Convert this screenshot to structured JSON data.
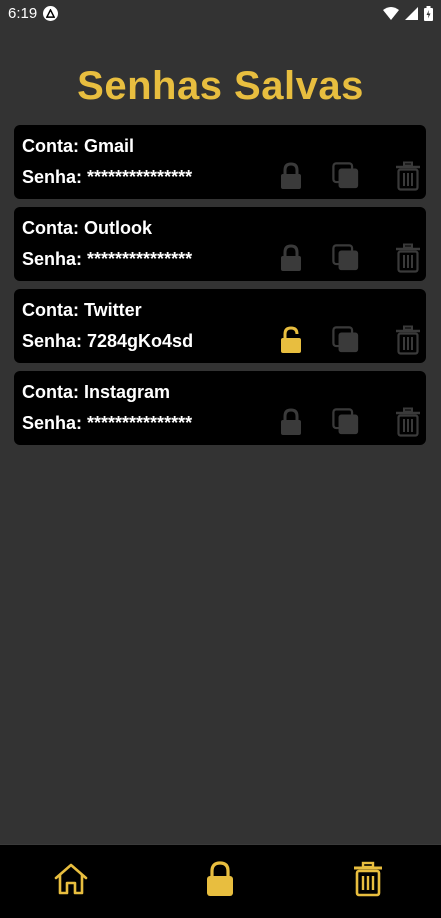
{
  "status_bar": {
    "time": "6:19"
  },
  "header": {
    "title": "Senhas Salvas"
  },
  "colors": {
    "accent": "#e8be3f",
    "background": "#333333",
    "card": "#000000",
    "icon_muted": "#3a3a3a"
  },
  "accounts": [
    {
      "account_label": "Conta: Gmail",
      "password_label": "Senha: ***************",
      "unlocked": false
    },
    {
      "account_label": "Conta: Outlook",
      "password_label": "Senha: ***************",
      "unlocked": false
    },
    {
      "account_label": "Conta: Twitter",
      "password_label": "Senha: 7284gKo4sd",
      "unlocked": true
    },
    {
      "account_label": "Conta: Instagram",
      "password_label": "Senha: ***************",
      "unlocked": false
    }
  ],
  "icons": {
    "card_actions": [
      "lock-icon",
      "copy-icon",
      "trash-icon"
    ],
    "bottom_nav": [
      "home-icon",
      "lock-icon",
      "trash-icon"
    ]
  }
}
